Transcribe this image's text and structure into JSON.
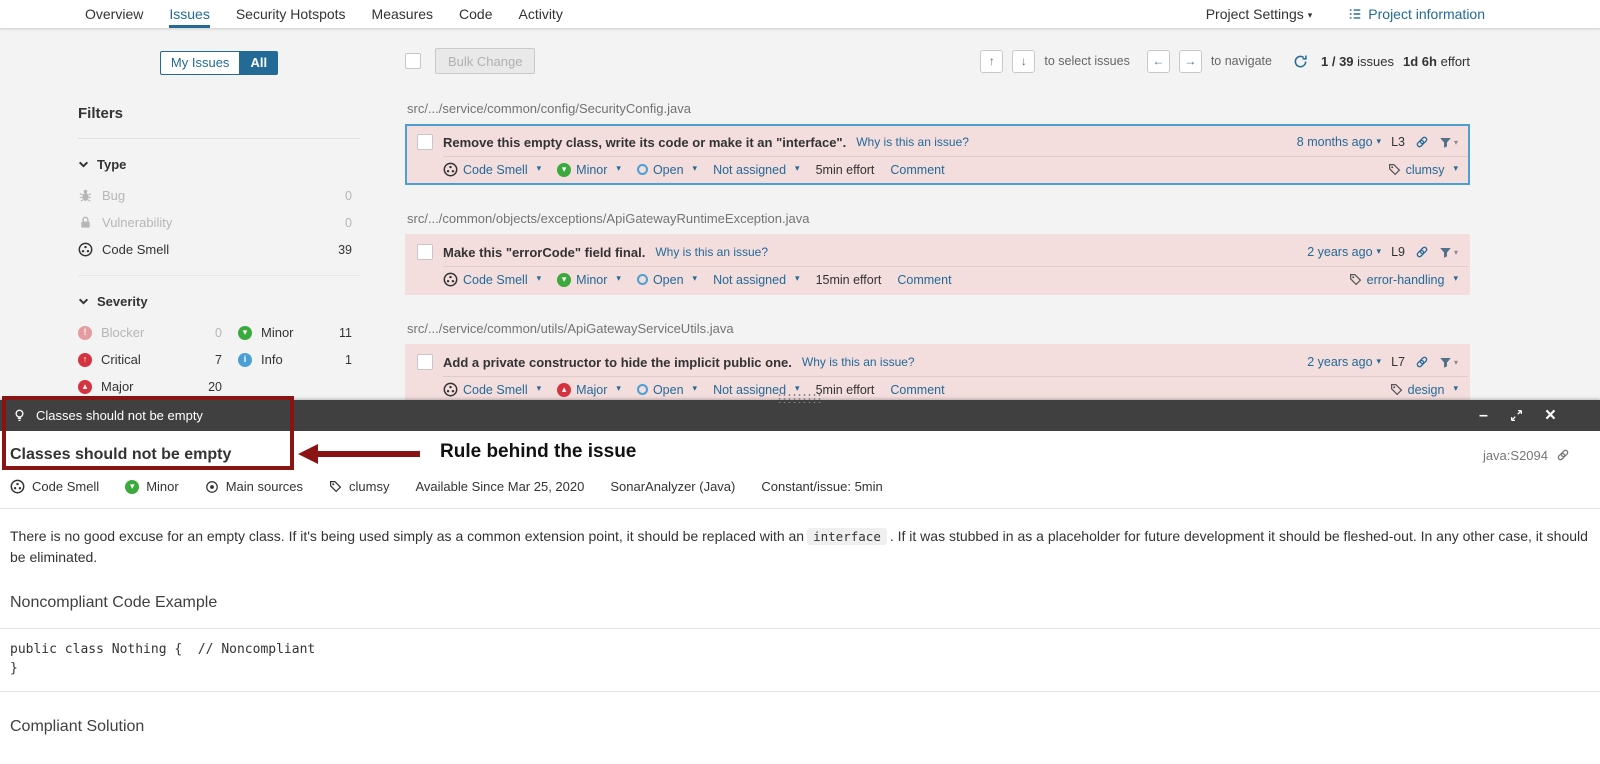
{
  "colors": {
    "accent_blue": "#236a97",
    "light_blue": "#4b9fd5",
    "issue_bg": "#f3dddd",
    "selected_issue_border": "#4b9fd5",
    "severity_red": "#d4333f",
    "severity_green": "#3ba93b",
    "severity_info_blue": "#4b9fd5",
    "panel_bar_bg": "#404040",
    "annotation_red": "#8a1414",
    "page_bg": "#f3f3f3"
  },
  "nav": {
    "tabs": [
      "Overview",
      "Issues",
      "Security Hotspots",
      "Measures",
      "Code",
      "Activity"
    ],
    "active_tab": "Issues",
    "project_settings": "Project Settings",
    "project_information": "Project information"
  },
  "sidebar": {
    "my_issues_label": "My Issues",
    "all_label": "All",
    "filters_title": "Filters",
    "type": {
      "title": "Type",
      "items": [
        {
          "label": "Bug",
          "count": "0"
        },
        {
          "label": "Vulnerability",
          "count": "0"
        },
        {
          "label": "Code Smell",
          "count": "39"
        }
      ]
    },
    "severity": {
      "title": "Severity",
      "items": [
        {
          "label": "Blocker",
          "count": "0"
        },
        {
          "label": "Minor",
          "count": "11"
        },
        {
          "label": "Critical",
          "count": "7"
        },
        {
          "label": "Info",
          "count": "1"
        },
        {
          "label": "Major",
          "count": "20"
        }
      ]
    }
  },
  "toolbar": {
    "bulk_change_label": "Bulk Change",
    "select_hint": "to select issues",
    "navigate_hint": "to navigate",
    "issues_counter": "1 / 39",
    "issues_counter_suffix": "issues",
    "effort_value": "1d 6h",
    "effort_suffix": "effort"
  },
  "issues": [
    {
      "file": "src/.../service/common/config/SecurityConfig.java",
      "title": "Remove this empty class, write its code or make it an \"interface\".",
      "why": "Why is this an issue?",
      "age": "8 months ago",
      "line": "L3",
      "type": "Code Smell",
      "severity": "Minor",
      "status": "Open",
      "assignee": "Not assigned",
      "effort": "5min effort",
      "comment": "Comment",
      "tag": "clumsy"
    },
    {
      "file": "src/.../common/objects/exceptions/ApiGatewayRuntimeException.java",
      "title": "Make this \"errorCode\" field final.",
      "why": "Why is this an issue?",
      "age": "2 years ago",
      "line": "L9",
      "type": "Code Smell",
      "severity": "Minor",
      "status": "Open",
      "assignee": "Not assigned",
      "effort": "15min effort",
      "comment": "Comment",
      "tag": "error-handling"
    },
    {
      "file": "src/.../service/common/utils/ApiGatewayServiceUtils.java",
      "title": "Add a private constructor to hide the implicit public one.",
      "why": "Why is this an issue?",
      "age": "2 years ago",
      "line": "L7",
      "type": "Code Smell",
      "severity": "Major",
      "status": "Open",
      "assignee": "Not assigned",
      "effort": "5min effort",
      "comment": "Comment",
      "tag": "design"
    }
  ],
  "rule_panel": {
    "header_title": "Classes should not be empty",
    "title": "Classes should not be empty",
    "rule_key": "java:S2094",
    "annotation_label": "Rule behind the issue",
    "meta": {
      "type": "Code Smell",
      "severity": "Minor",
      "scope": "Main sources",
      "tag": "clumsy",
      "available_since": "Available Since Mar 25, 2020",
      "analyzer": "SonarAnalyzer (Java)",
      "constant_effort": "Constant/issue: 5min"
    },
    "description": {
      "before_code": "There is no good excuse for an empty class. If it's being used simply as a common extension point, it should be replaced with an",
      "code": "interface",
      "after_code": ". If it was stubbed in as a placeholder for future development it should be fleshed-out. In any other case, it should be eliminated."
    },
    "noncompliant_heading": "Noncompliant Code Example",
    "code_block": "public class Nothing {  // Noncompliant\n}",
    "compliant_heading": "Compliant Solution"
  }
}
